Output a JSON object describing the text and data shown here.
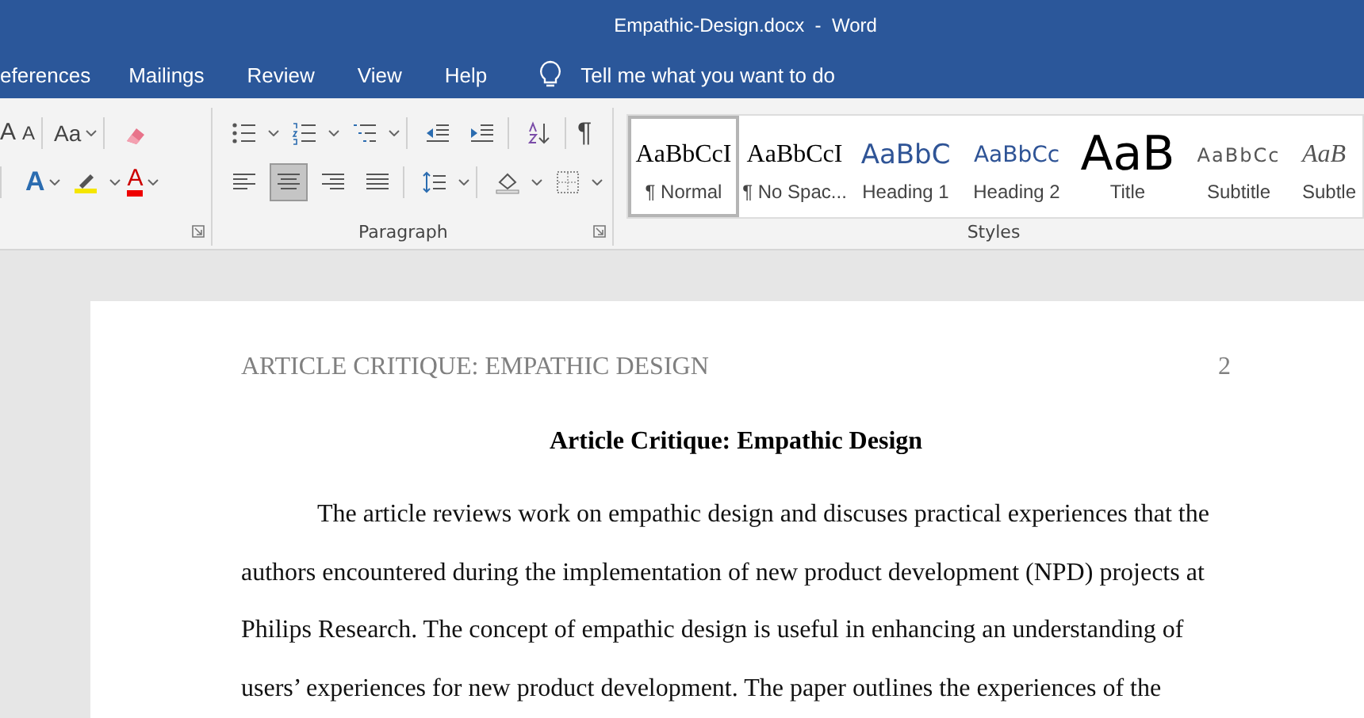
{
  "window": {
    "title": "Empathic-Design.docx  -  Word"
  },
  "tabs": [
    {
      "label": "eferences"
    },
    {
      "label": "Mailings"
    },
    {
      "label": "Review"
    },
    {
      "label": "View"
    },
    {
      "label": "Help"
    }
  ],
  "tell_me": {
    "placeholder": "Tell me what you want to do"
  },
  "font_group": {
    "row_1": [
      {
        "kind": "grow",
        "label": "A"
      },
      {
        "kind": "shrink",
        "label": "A"
      },
      {
        "kind": "case",
        "label": "Aa"
      },
      {
        "kind": "clear"
      }
    ],
    "row_2": [
      {
        "kind": "effects",
        "label": "A"
      },
      {
        "kind": "highlight"
      },
      {
        "kind": "fontcolor",
        "label": "A"
      }
    ]
  },
  "paragraph_group": {
    "label": "Paragraph",
    "row_1": [
      {
        "kind": "bullets"
      },
      {
        "kind": "numbering"
      },
      {
        "kind": "multilevel"
      },
      {
        "kind": "outdent"
      },
      {
        "kind": "indent"
      },
      {
        "kind": "sort"
      },
      {
        "kind": "marks",
        "label": "¶"
      }
    ],
    "row_2": [
      {
        "kind": "left",
        "selected": false
      },
      {
        "kind": "center",
        "selected": true
      },
      {
        "kind": "right",
        "selected": false
      },
      {
        "kind": "justify",
        "selected": false
      },
      {
        "kind": "spacing"
      },
      {
        "kind": "shading"
      },
      {
        "kind": "borders"
      }
    ]
  },
  "styles_group": {
    "label": "Styles",
    "items": [
      {
        "sample": "AaBbCcI",
        "name": "¶ Normal",
        "kind": "normal",
        "selected": true
      },
      {
        "sample": "AaBbCcI",
        "name": "¶ No Spac...",
        "kind": "normal",
        "selected": false
      },
      {
        "sample": "AaBbC",
        "name": "Heading 1",
        "kind": "heading1",
        "selected": false
      },
      {
        "sample": "AaBbCc",
        "name": "Heading 2",
        "kind": "heading2",
        "selected": false
      },
      {
        "sample": "AaB",
        "name": "Title",
        "kind": "title",
        "selected": false
      },
      {
        "sample": "AaBbCc",
        "name": "Subtitle",
        "kind": "subtitle",
        "selected": false
      },
      {
        "sample": "AaB",
        "name": "Subtle",
        "kind": "subtle",
        "selected": false
      }
    ]
  },
  "document": {
    "header": "ARTICLE CRITIQUE: EMPATHIC DESIGN",
    "page_number": "2",
    "title": "Article Critique: Empathic Design",
    "paragraph": "The article reviews work on empathic design and discuses practical experiences that the authors encountered during the implementation of new product development (NPD) projects at Philips Research. The concept of empathic design is useful in enhancing an understanding of users’ experiences for new product development. The paper outlines the experiences of the"
  }
}
